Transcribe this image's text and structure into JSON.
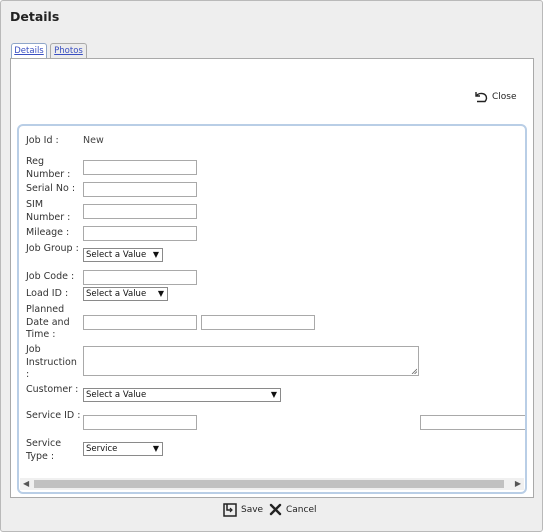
{
  "dialog": {
    "title": "Details"
  },
  "tabs": [
    {
      "label": "Details"
    },
    {
      "label": "Photos"
    }
  ],
  "toolbar": {
    "close_label": "Close"
  },
  "form": {
    "job_id": {
      "label": "Job Id :",
      "value": "New"
    },
    "reg_number": {
      "label": "Reg Number :",
      "value": ""
    },
    "serial_no": {
      "label": "Serial No :",
      "value": ""
    },
    "sim_number": {
      "label": "SIM Number :",
      "value": ""
    },
    "mileage": {
      "label": "Mileage :",
      "value": ""
    },
    "job_group": {
      "label": "Job Group :",
      "selected": "Select a Value"
    },
    "job_code": {
      "label": "Job Code :",
      "value": ""
    },
    "load_id": {
      "label": "Load ID :",
      "selected": "Select a Value"
    },
    "planned": {
      "label": "Planned Date and Time :",
      "date": "",
      "time": ""
    },
    "job_instruction": {
      "label": "Job Instruction :",
      "value": ""
    },
    "customer": {
      "label": "Customer :",
      "selected": "Select a Value"
    },
    "service_id": {
      "label": "Service ID :",
      "value": "",
      "value2": ""
    },
    "service_type": {
      "label": "Service Type :",
      "selected": "Service"
    }
  },
  "footer": {
    "save_label": "Save",
    "cancel_label": "Cancel"
  }
}
